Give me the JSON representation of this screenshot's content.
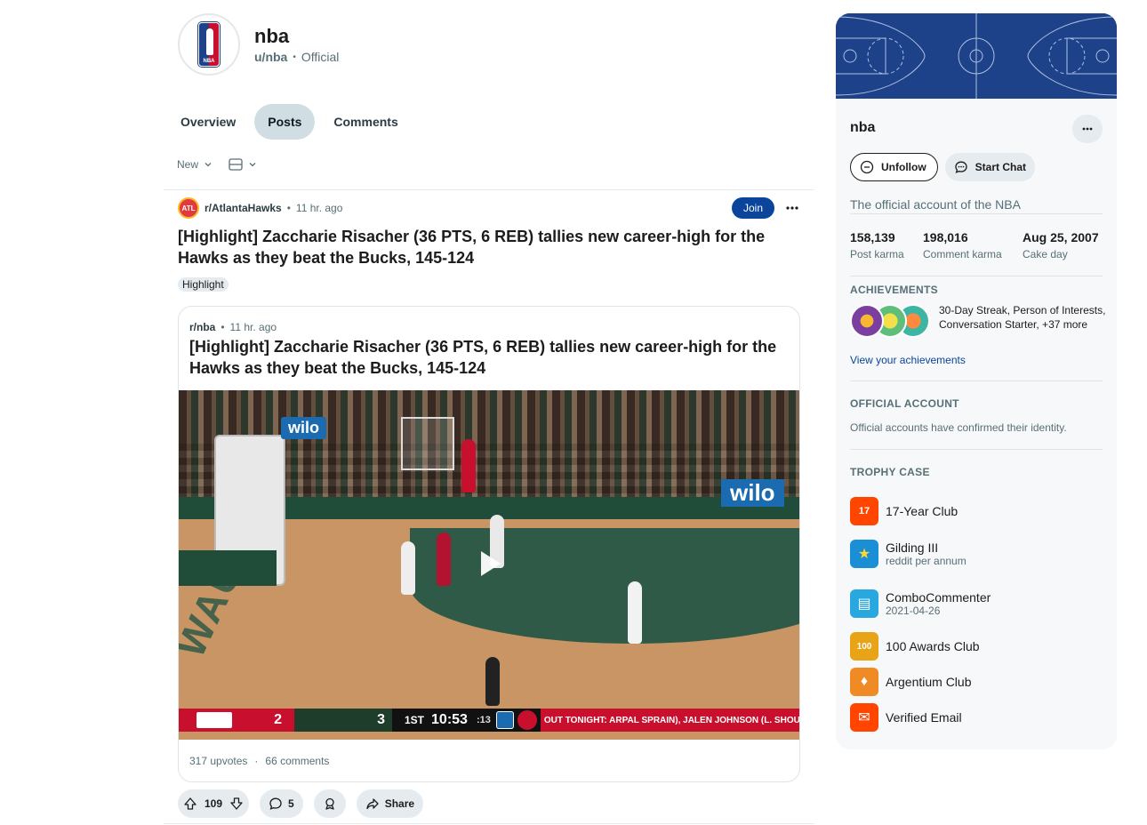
{
  "profile": {
    "name": "nba",
    "username": "u/nba",
    "badge": "Official",
    "logo_text": "NBA"
  },
  "tabs": [
    {
      "label": "Overview"
    },
    {
      "label": "Posts",
      "active": true
    },
    {
      "label": "Comments"
    }
  ],
  "filters": {
    "sort": "New"
  },
  "post": {
    "subreddit": "r/AtlantaHawks",
    "subreddit_icon_text": "ATL",
    "time": "11 hr. ago",
    "join_label": "Join",
    "title": "[Highlight] Zaccharie Risacher (36 PTS, 6 REB) tallies new career-high for the Hawks as they beat the Bucks, 145-124",
    "flair": "Highlight",
    "crosspost": {
      "subreddit": "r/nba",
      "time": "11 hr. ago",
      "title": "[Highlight] Zaccharie Risacher (36 PTS, 6 REB) tallies new career-high for the Hawks as they beat the Bucks, 145-124",
      "upvotes": "317 upvotes",
      "comments": "66 comments",
      "video": {
        "ad_text": "wilo",
        "ad_text_2": "wilo",
        "baseline_text": "WAUKEE",
        "scorebug": {
          "team1_score": "2",
          "team2_score": "3",
          "period": "1ST",
          "clock": "10:53",
          "shot_clock": ":13",
          "ticker": "OUT TONIGHT: ARPAL SPRAIN), JALEN JOHNSON (L. SHOULDE"
        }
      }
    },
    "actions": {
      "votes": "109",
      "comments": "5",
      "share_label": "Share"
    }
  },
  "sidebar": {
    "name": "nba",
    "unfollow_label": "Unfollow",
    "chat_label": "Start Chat",
    "description": "The official account of the NBA",
    "stats": [
      {
        "value": "158,139",
        "label": "Post karma"
      },
      {
        "value": "198,016",
        "label": "Comment karma"
      },
      {
        "value": "Aug 25, 2007",
        "label": "Cake day"
      }
    ],
    "achievements": {
      "title": "ACHIEVEMENTS",
      "text": "30-Day Streak, Person of Interests, Conversation Starter, +37 more",
      "link": "View your achievements"
    },
    "official": {
      "title": "OFFICIAL ACCOUNT",
      "text": "Official accounts have confirmed their identity."
    },
    "trophies": {
      "title": "TROPHY CASE",
      "items": [
        {
          "name": "17-Year Club",
          "sub": "",
          "icon": "17",
          "color": "#ff4500"
        },
        {
          "name": "Gilding III",
          "sub": "reddit per annum",
          "icon": "★",
          "color": "#1b8fd6"
        },
        {
          "name": "ComboCommenter",
          "sub": "2021-04-26",
          "icon": "▤",
          "color": "#29a8e0"
        },
        {
          "name": "100 Awards Club",
          "sub": "",
          "icon": "100",
          "color": "#e8a317"
        },
        {
          "name": "Argentium Club",
          "sub": "",
          "icon": "♦",
          "color": "#f08a24"
        },
        {
          "name": "Verified Email",
          "sub": "",
          "icon": "✉",
          "color": "#ff4500"
        }
      ]
    }
  }
}
